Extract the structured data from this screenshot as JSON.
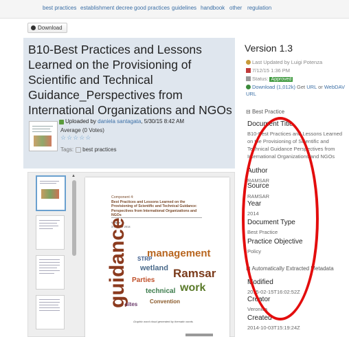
{
  "tag_links": [
    "best practices",
    "establishment decree",
    "good practices",
    "guidelines",
    "handbook",
    "other",
    "regulation"
  ],
  "download_button": "Download",
  "document": {
    "title": "B10-Best Practices and Lessons Learned on the Provisioning of Scientific and Technical Guidance_Perspectives from International Organizations and NGOs",
    "uploaded_prefix": "Uploaded by",
    "uploader": "daniela santagata",
    "uploaded_date": "5/30/15 8:42 AM",
    "average": "Average (0 Votes)",
    "stars": "☆☆☆☆☆",
    "tags_label": "Tags:",
    "tag": "best practices"
  },
  "preview": {
    "heading_lines": [
      "Component 4:",
      "Best Practices and Lessons Learned on the",
      "Provisioning of Scientific and Technical Guidance:",
      "Perspectives from International Organizations and",
      "NGOs"
    ],
    "meta_line1": "Version 1a",
    "meta_line2": "3 October 2014",
    "caption": "Graphic word cloud generated by thematic words",
    "words": [
      "guidance",
      "management",
      "Ramsar",
      "work",
      "wetland",
      "Parties",
      "technical",
      "Convention",
      "STRP",
      "sites"
    ]
  },
  "sidebar": {
    "version": "Version 1.3",
    "last_updated": "Last Updated by Luigi Potenza",
    "date": "7/12/15 1:36 PM",
    "status_label": "Status:",
    "status": "Approved",
    "download": "Download (1,012k)",
    "get_url_prefix": "Get",
    "url": "URL",
    "or": "or",
    "webdav": "WebDAV URL",
    "best_practice_section": "Best Practice",
    "fields": [
      {
        "label": "Document Title",
        "value": "B10-Best Practices and Lessons Learned on the Provisioning of Scientific and Technical Guidance Perspectives from International Organizations and NGOs"
      },
      {
        "label": "Author",
        "value": "RAMSAR"
      },
      {
        "label": "Source",
        "value": "RAMSAR"
      },
      {
        "label": "Year",
        "value": "2014"
      },
      {
        "label": "Document Type",
        "value": "Best Practice"
      },
      {
        "label": "Practice Objective",
        "value": "Policy"
      }
    ],
    "auto_section": "Automatically Extracted Metadata",
    "auto_fields": [
      {
        "label": "Modified",
        "value": "2015-02-15T16:02:52Z"
      },
      {
        "label": "Creator",
        "value": "Veronica"
      },
      {
        "label": "Created",
        "value": "2014-10-03T15:19:24Z"
      }
    ]
  },
  "colors": {
    "annotation": "#e30d0d",
    "link": "#3a6ea5",
    "approved": "#3f9a3f"
  }
}
